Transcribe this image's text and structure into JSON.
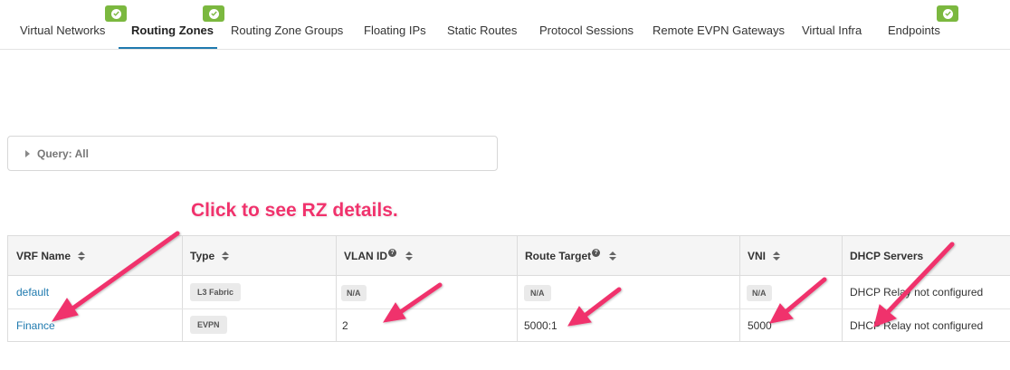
{
  "tabs": [
    {
      "label": "Virtual Networks",
      "badge": true
    },
    {
      "label": "Routing Zones",
      "badge": true,
      "active": true
    },
    {
      "label": "Routing Zone Groups",
      "badge": false
    },
    {
      "label": "Floating IPs",
      "badge": false
    },
    {
      "label": "Static Routes",
      "badge": false
    },
    {
      "label": "Protocol Sessions",
      "badge": false
    },
    {
      "label": "Remote EVPN Gateways",
      "badge": false
    },
    {
      "label": "Virtual Infra",
      "badge": false
    },
    {
      "label": "Endpoints",
      "badge": true
    }
  ],
  "query": {
    "label": "Query: All"
  },
  "annotation": {
    "text": "Click to see RZ details."
  },
  "table": {
    "columns": {
      "vrf_name": "VRF Name",
      "type": "Type",
      "vlan_id": "VLAN ID",
      "route_target": "Route Target",
      "vni": "VNI",
      "dhcp_servers": "DHCP Servers"
    },
    "help_glyph": "?",
    "rows": [
      {
        "vrf_name": "default",
        "type": "L3 Fabric",
        "vlan_id": "N/A",
        "route_target": "N/A",
        "vni": "N/A",
        "dhcp": "DHCP Relay not configured"
      },
      {
        "vrf_name": "Finance",
        "type": "EVPN",
        "vlan_id": "2",
        "route_target": "5000:1",
        "vni": "5000",
        "dhcp": "DHCP Relay not configured"
      }
    ]
  },
  "colors": {
    "accent": "#1f7aaf",
    "badge": "#7bb83f",
    "annotation": "#f0326c"
  },
  "icons": {
    "badge": "check-circle-icon",
    "query_toggle": "caret-right-icon",
    "sort": "sort-icon",
    "help": "help-circle-icon",
    "annotation_arrow": "arrow-icon"
  }
}
